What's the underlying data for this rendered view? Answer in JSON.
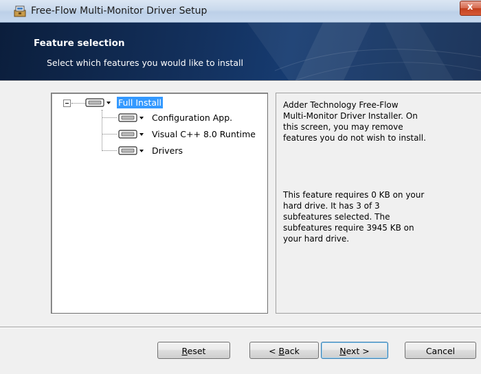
{
  "window": {
    "title": "Free-Flow Multi-Monitor Driver Setup",
    "close_glyph": "x"
  },
  "banner": {
    "title": "Feature selection",
    "subtitle": "Select which features you would like to install"
  },
  "tree": {
    "root": {
      "label": "Full Install",
      "icon": "drive-icon",
      "expanded": true,
      "selected": true
    },
    "children": [
      {
        "label": "Configuration App.",
        "icon": "drive-icon"
      },
      {
        "label": "Visual C++ 8.0 Runtime",
        "icon": "drive-icon"
      },
      {
        "label": "Drivers",
        "icon": "drive-icon"
      }
    ]
  },
  "description": {
    "lines_1": [
      "Adder Technology Free-Flow",
      "Multi-Monitor Driver Installer. On",
      "this screen, you may remove",
      "features you do not wish to install."
    ],
    "lines_2": [
      "This feature requires 0 KB on your",
      "hard drive. It has 3 of 3",
      "subfeatures selected. The",
      "subfeatures require 3945 KB on",
      "your hard drive."
    ]
  },
  "buttons": {
    "reset": {
      "mnemonic": "R",
      "rest": "eset"
    },
    "back": {
      "prefix": "< ",
      "mnemonic": "B",
      "rest": "ack"
    },
    "next": {
      "mnemonic": "N",
      "rest": "ext >"
    },
    "cancel": {
      "label": "Cancel"
    }
  },
  "colors": {
    "selection": "#3399ff",
    "banner": "#13305c"
  }
}
